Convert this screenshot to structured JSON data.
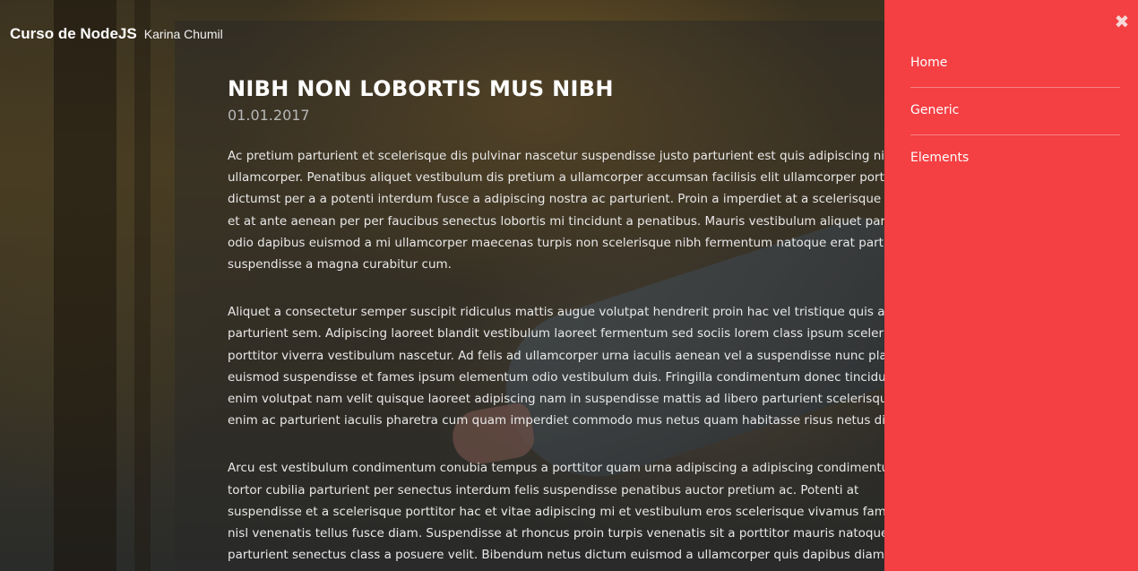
{
  "header": {
    "brand": "Curso de NodeJS",
    "byline": "Karina Chumil"
  },
  "post": {
    "title": "NIBH NON LOBORTIS MUS NIBH",
    "date": "01.01.2017",
    "paragraphs": [
      [
        "Ac pretium parturient et scelerisque dis pulvinar nascetur suspendisse justo parturient est quis adipiscing nisi di",
        "ullamcorper. Penatibus aliquet vestibulum dis pretium a ullamcorper accumsan facilisis elit ullamcorper porttitor",
        "dictumst per a a potenti interdum fusce a adipiscing nostra ac parturient. Proin a imperdiet at a scelerisque qua",
        "et at ante aenean per per faucibus senectus lobortis mi tincidunt a penatibus. Mauris vestibulum aliquet parturic",
        "odio dapibus euismod a mi ullamcorper maecenas turpis non scelerisque nibh fermentum natoque erat parturi",
        "suspendisse a magna curabitur cum."
      ],
      [
        "Aliquet a consectetur semper suscipit ridiculus mattis augue volutpat hendrerit proin hac vel tristique quis amet",
        "parturient sem. Adipiscing laoreet blandit vestibulum laoreet fermentum sed sociis lorem class ipsum scelerisqu",
        "porttitor viverra vestibulum nascetur. Ad felis ad ullamcorper urna iaculis aenean vel a suspendisse nunc placera",
        "euismod suspendisse et fames ipsum elementum odio vestibulum duis. Fringilla condimentum donec tincidunt",
        "enim volutpat nam velit quisque laoreet adipiscing nam in suspendisse mattis ad libero parturient scelerisque. V",
        "enim ac parturient iaculis pharetra cum quam imperdiet commodo mus netus quam habitasse risus netus dis."
      ],
      [
        "Arcu est vestibulum condimentum conubia tempus a porttitor quam urna adipiscing a adipiscing condimentum",
        "tortor cubilia parturient per senectus interdum felis suspendisse penatibus auctor pretium ac. Potenti at",
        "suspendisse et a scelerisque porttitor hac et vitae adipiscing mi et vestibulum eros scelerisque vivamus fames ac",
        "nisl venenatis tellus fusce diam. Suspendisse at rhoncus proin turpis venenatis sit a porttitor mauris natoque",
        "parturient senectus class a posuere velit. Bibendum netus dictum euismod a ullamcorper quis dapibus diam"
      ]
    ]
  },
  "menu": {
    "close_icon": "close-icon",
    "close_glyph": "✖",
    "items": [
      {
        "label": "Home"
      },
      {
        "label": "Generic"
      },
      {
        "label": "Elements"
      }
    ]
  },
  "colors": {
    "menu_background": "#f43f43",
    "title_text": "#ffffff",
    "date_text": "#b8b8b8"
  }
}
